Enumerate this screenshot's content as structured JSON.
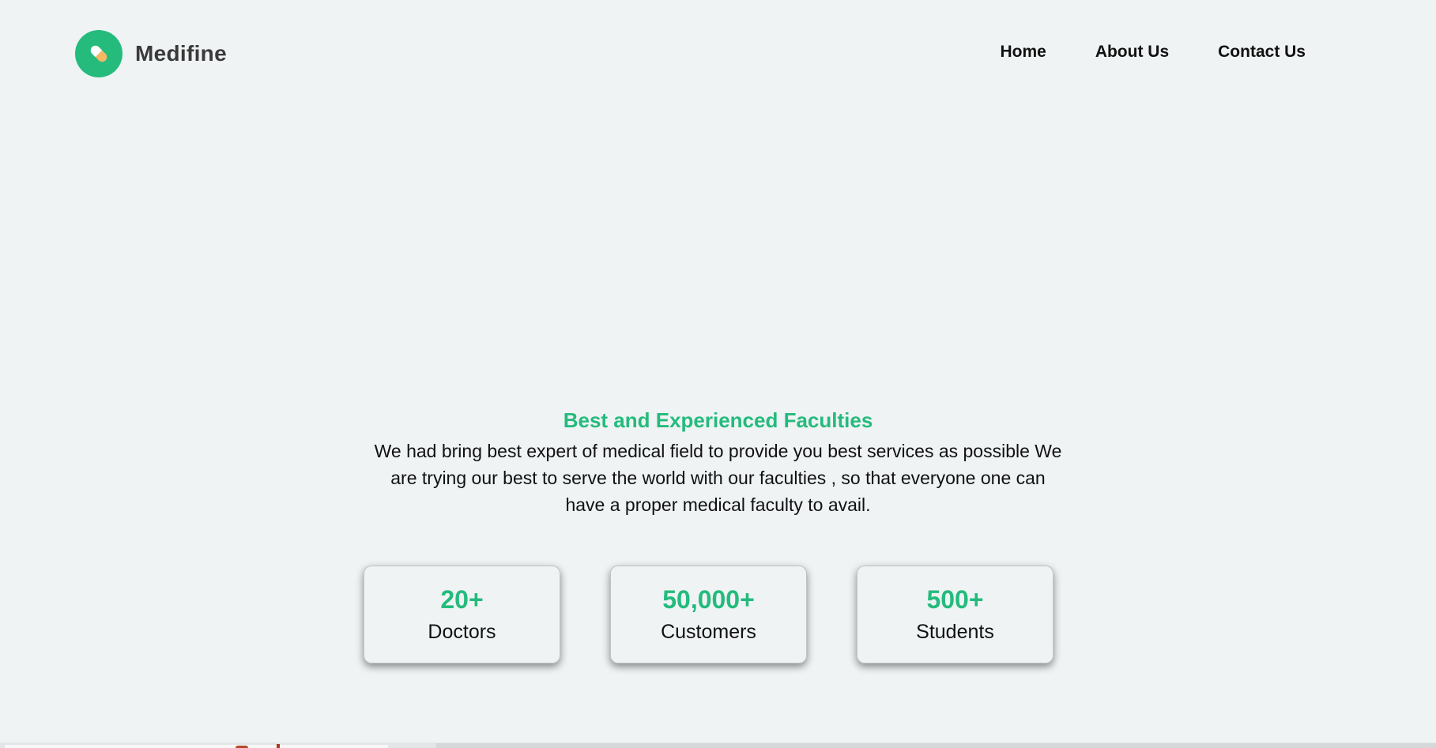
{
  "brand": {
    "name": "Medifine",
    "logo_icon": "pill-icon",
    "accent_color": "#24bb7d"
  },
  "nav": {
    "items": [
      {
        "label": "Home"
      },
      {
        "label": "About Us"
      },
      {
        "label": "Contact Us"
      }
    ]
  },
  "faculty_section": {
    "title": "Best and Experienced Faculties",
    "description": "We had bring best expert of medical field to provide you best services as possible We are trying our best to serve the world with our faculties , so that everyone one can have a proper medical faculty to avail."
  },
  "stats": [
    {
      "value": "20+",
      "label": "Doctors"
    },
    {
      "value": "50,000+",
      "label": "Customers"
    },
    {
      "value": "500+",
      "label": "Students"
    }
  ]
}
